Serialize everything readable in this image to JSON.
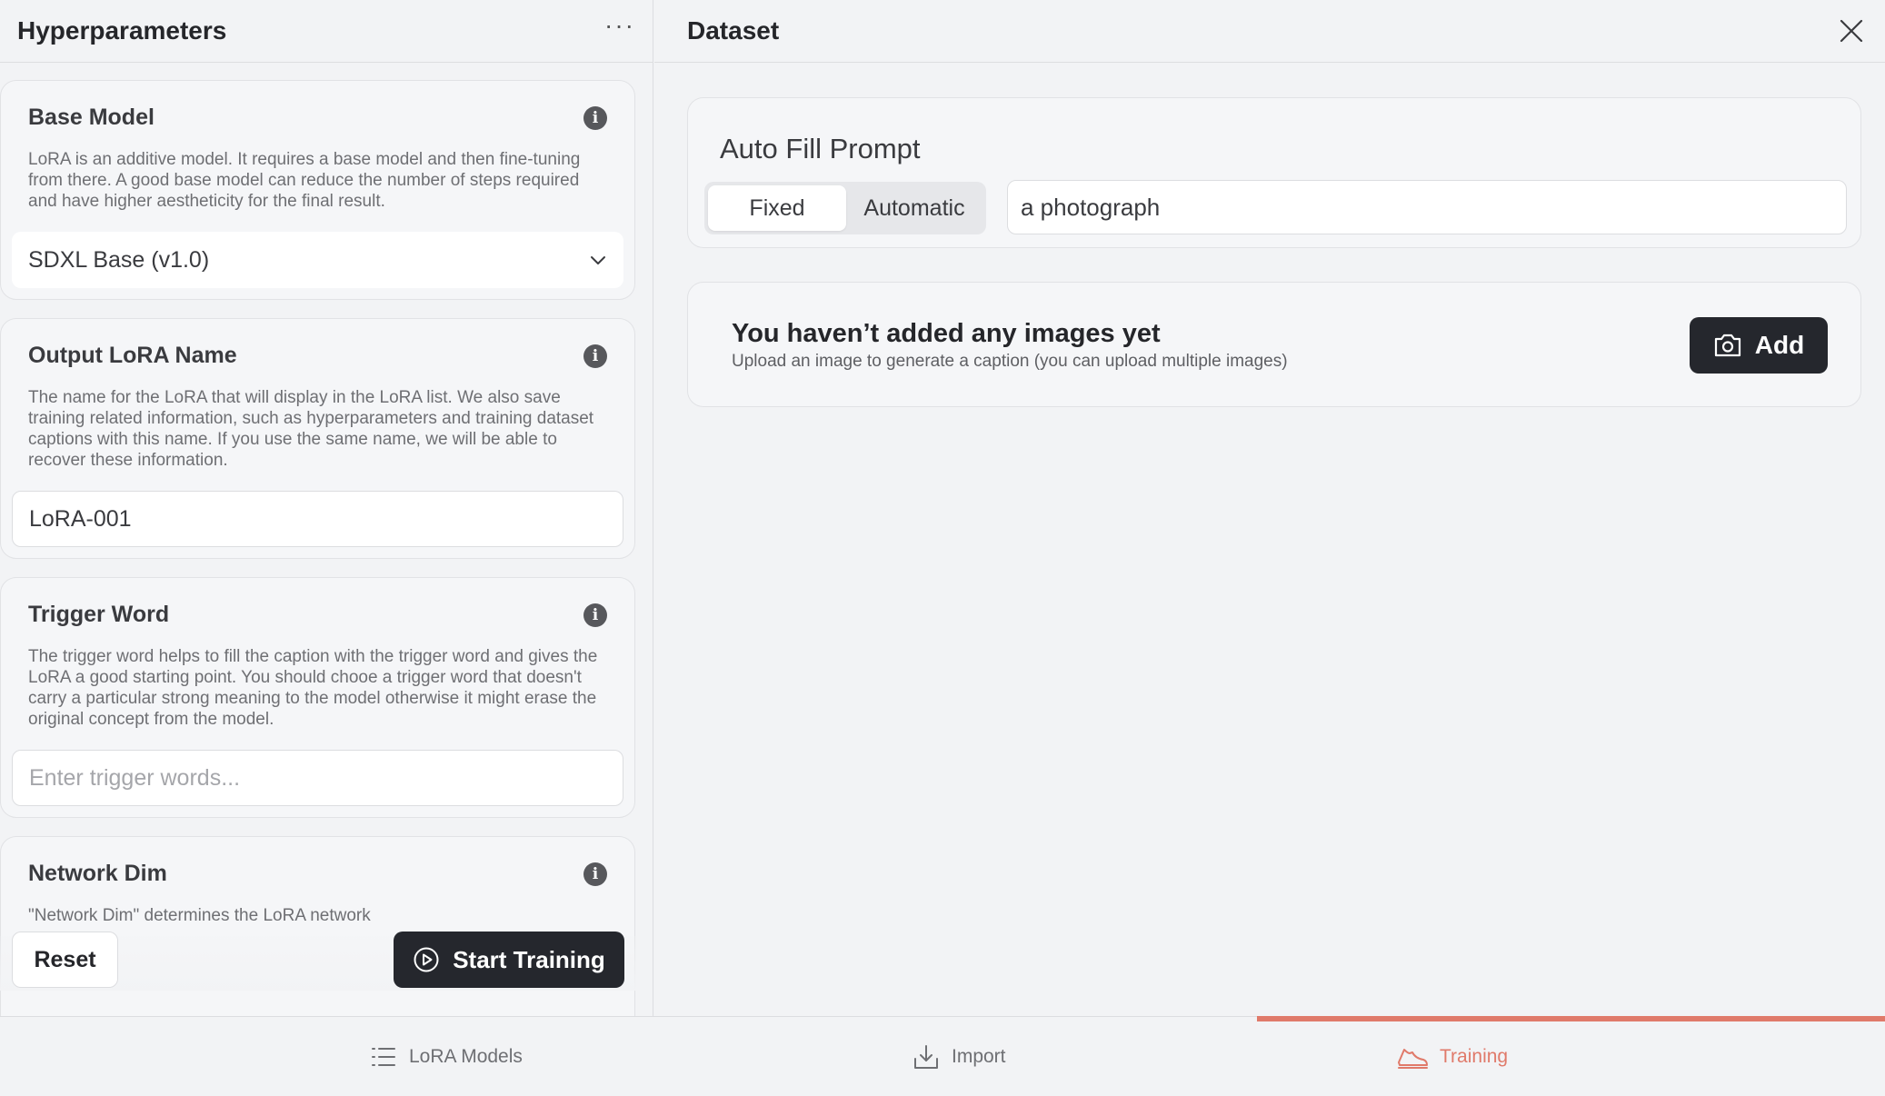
{
  "left_panel": {
    "title": "Hyperparameters",
    "more_label": "···",
    "base_model": {
      "title": "Base Model",
      "description": "LoRA is an additive model. It requires a base model and then fine-tuning from there. A good base model can reduce the number of steps required and have higher aestheticity for the final result.",
      "selected": "SDXL Base (v1.0)"
    },
    "output_name": {
      "title": "Output LoRA Name",
      "description": "The name for the LoRA that will display in the LoRA list. We also save training related information, such as hyperparameters and training dataset captions with this name. If you use the same name, we will be able to recover these information.",
      "value": "LoRA-001"
    },
    "trigger_word": {
      "title": "Trigger Word",
      "description": "The trigger word helps to fill the caption with the trigger word and gives the LoRA a good starting point. You should chooe a trigger word that doesn't carry a particular strong meaning to the model otherwise it might erase the original concept from the model.",
      "placeholder": "Enter trigger words..."
    },
    "network_dim": {
      "title": "Network Dim",
      "description": "\"Network Dim\" determines the LoRA network"
    },
    "reset_label": "Reset",
    "start_label": "Start Training"
  },
  "right_panel": {
    "title": "Dataset",
    "auto_fill": {
      "title": "Auto Fill Prompt",
      "modes": [
        "Fixed",
        "Automatic"
      ],
      "selected_mode": "Fixed",
      "prompt_value": "a photograph"
    },
    "empty_state": {
      "title": "You haven’t added any images yet",
      "subtitle": "Upload an image to generate a caption (you can upload multiple images)",
      "add_label": "Add"
    }
  },
  "tabs": [
    {
      "label": "LoRA Models",
      "icon": "list-icon",
      "active": false
    },
    {
      "label": "Import",
      "icon": "import-icon",
      "active": false
    },
    {
      "label": "Training",
      "icon": "training-icon",
      "active": true
    }
  ],
  "colors": {
    "accent": "#e07a6a",
    "dark_button": "#25272d",
    "background": "#f2f3f5"
  }
}
